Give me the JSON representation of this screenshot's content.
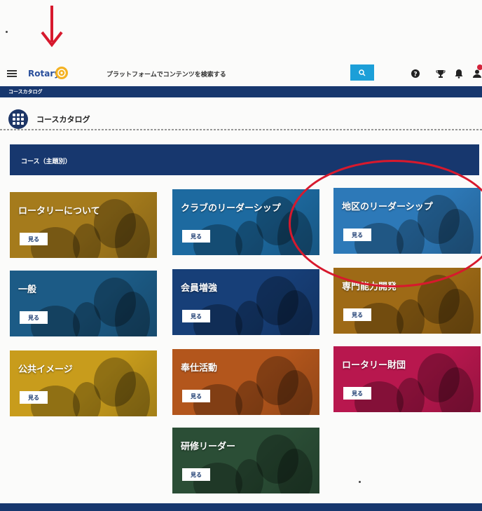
{
  "header": {
    "logo_text": "Rotary",
    "search_text": "プラットフォームでコンテンツを検索する"
  },
  "breadcrumb": "コースカタログ",
  "page_title": "コースカタログ",
  "section_label": "コース（主題別）",
  "view_label": "見る",
  "cards": [
    {
      "title": "ロータリーについて",
      "color": "#a57b1c"
    },
    {
      "title": "クラブのリーダーシップ",
      "color": "#1d6aa0"
    },
    {
      "title": "地区のリーダーシップ",
      "color": "#2d79b8"
    },
    {
      "title": "一般",
      "color": "#1c5b86"
    },
    {
      "title": "会員増強",
      "color": "#173f78"
    },
    {
      "title": "専門能力開発",
      "color": "#9e6a16"
    },
    {
      "title": "公共イメージ",
      "color": "#c89c1c"
    },
    {
      "title": "奉仕活動",
      "color": "#b3561c"
    },
    {
      "title": "ロータリー財団",
      "color": "#b8174e"
    },
    {
      "title": "研修リーダー",
      "color": "#2b4e36"
    }
  ],
  "colors": {
    "navy": "#17376e",
    "search_blue": "#1c9fd8",
    "annotation_red": "#d7192d",
    "rotary_gold": "#f4b223"
  },
  "icons": [
    "red-down-arrow-icon",
    "hamburger-menu-icon",
    "rotary-wheel-icon",
    "search-icon",
    "help-icon",
    "trophy-icon",
    "bell-icon",
    "user-icon",
    "grid-icon"
  ]
}
